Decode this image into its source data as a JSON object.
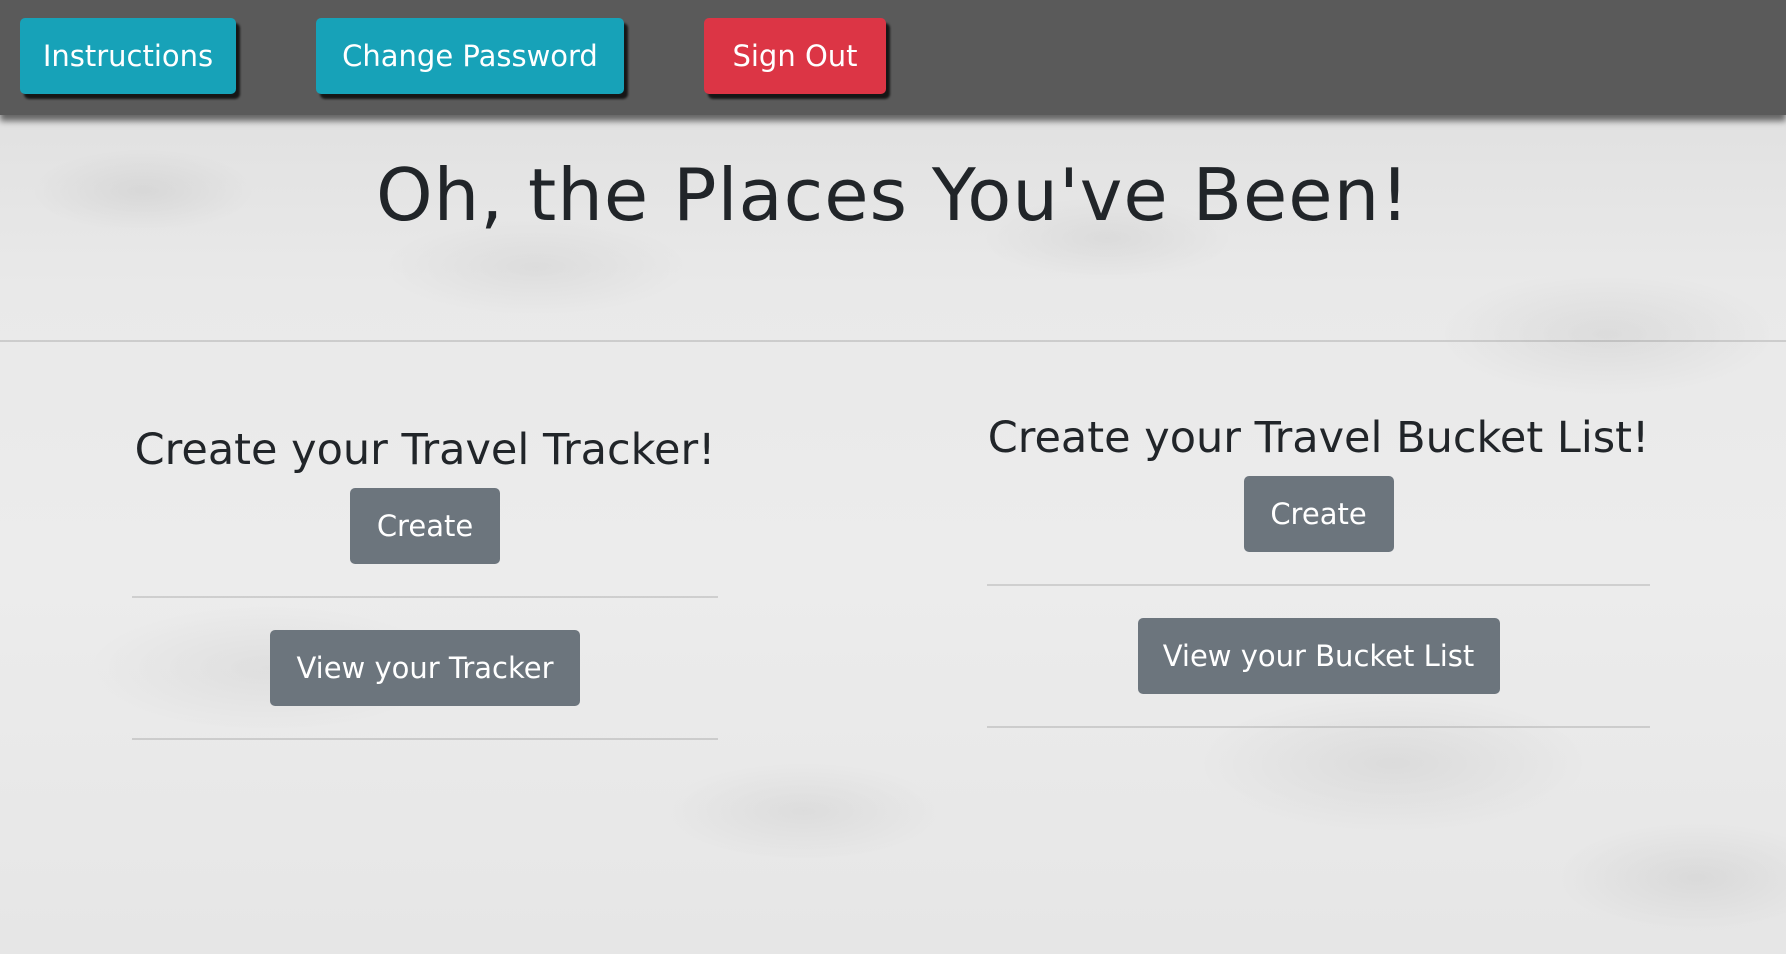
{
  "nav": {
    "instructions_label": "Instructions",
    "change_password_label": "Change Password",
    "sign_out_label": "Sign Out"
  },
  "page": {
    "title": "Oh, the Places You've Been!"
  },
  "tracker": {
    "heading": "Create your Travel Tracker!",
    "create_label": "Create",
    "view_label": "View your Tracker"
  },
  "bucket_list": {
    "heading": "Create your Travel Bucket List!",
    "create_label": "Create",
    "view_label": "View your Bucket List"
  },
  "colors": {
    "navbar": "#5a5a5a",
    "info": "#17a2b8",
    "danger": "#dc3545",
    "secondary": "#6c757d",
    "text": "#212529"
  }
}
